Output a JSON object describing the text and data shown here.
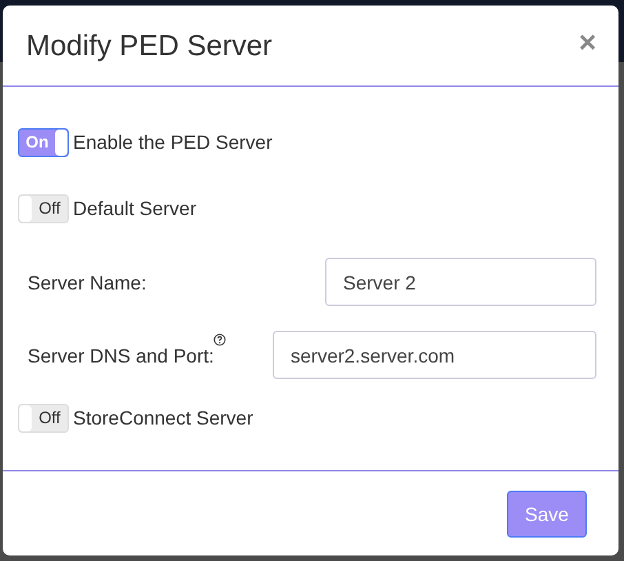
{
  "dialog": {
    "title": "Modify PED Server",
    "close": "×"
  },
  "toggles_top": [
    {
      "label": "Enable the PED Server",
      "state_text": "On",
      "on": true
    },
    {
      "label": "Default Server",
      "state_text": "Off",
      "on": false
    }
  ],
  "fields": [
    {
      "label": "Server Name:",
      "value": "Server 2",
      "help": false
    },
    {
      "label": "Server DNS and Port:",
      "value": "server2.server.com",
      "help": true
    }
  ],
  "toggles_bottom": [
    {
      "label": "StoreConnect Server",
      "state_text": "Off",
      "on": false
    }
  ],
  "buttons": [
    {
      "label": "Save"
    }
  ]
}
